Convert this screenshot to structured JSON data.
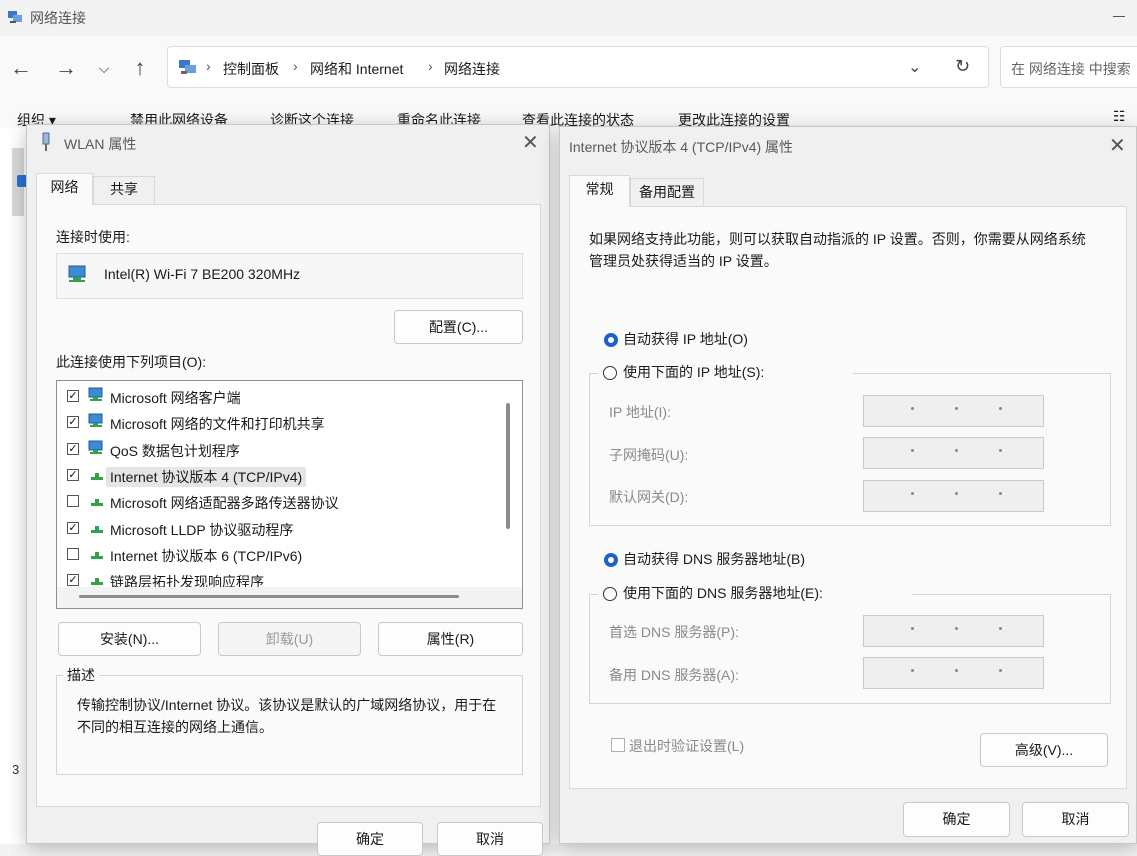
{
  "explorer": {
    "title": "网络连接",
    "breadcrumb": [
      "控制面板",
      "网络和 Internet",
      "网络连接"
    ],
    "search_placeholder": "在 网络连接 中搜索",
    "commands": [
      "组织 ▾",
      "禁用此网络设备",
      "诊断这个连接",
      "重命名此连接",
      "查看此连接的状态",
      "更改此连接的设置"
    ],
    "status_count": "3"
  },
  "wlan": {
    "title": "WLAN 属性",
    "tabs": [
      "网络",
      "共享"
    ],
    "connect_using_label": "连接时使用:",
    "adapter_name": "Intel(R) Wi-Fi 7 BE200 320MHz",
    "configure_button": "配置(C)...",
    "items_label": "此连接使用下列项目(O):",
    "items": [
      {
        "checked": true,
        "text": "Microsoft 网络客户端",
        "icon": "network-client-icon"
      },
      {
        "checked": true,
        "text": "Microsoft 网络的文件和打印机共享",
        "icon": "network-client-icon"
      },
      {
        "checked": true,
        "text": "QoS 数据包计划程序",
        "icon": "network-client-icon"
      },
      {
        "checked": true,
        "text": "Internet 协议版本 4 (TCP/IPv4)",
        "icon": "protocol-icon",
        "selected": true
      },
      {
        "checked": false,
        "text": "Microsoft 网络适配器多路传送器协议",
        "icon": "protocol-icon"
      },
      {
        "checked": true,
        "text": "Microsoft LLDP 协议驱动程序",
        "icon": "protocol-icon"
      },
      {
        "checked": false,
        "text": "Internet 协议版本 6 (TCP/IPv6)",
        "icon": "protocol-icon"
      },
      {
        "checked": true,
        "text": "链路层拓扑发现响应程序",
        "icon": "protocol-icon"
      }
    ],
    "install_button": "安装(N)...",
    "uninstall_button": "卸载(U)",
    "properties_button": "属性(R)",
    "description_title": "描述",
    "description_text": "传输控制协议/Internet 协议。该协议是默认的广域网络协议，用于在不同的相互连接的网络上通信。",
    "ok_button": "确定",
    "cancel_button": "取消"
  },
  "ipv4": {
    "title": "Internet 协议版本 4 (TCP/IPv4) 属性",
    "tabs": [
      "常规",
      "备用配置"
    ],
    "intro": "如果网络支持此功能，则可以获取自动指派的 IP 设置。否则，你需要从网络系统管理员处获得适当的 IP 设置。",
    "auto_ip": "自动获得 IP 地址(O)",
    "manual_ip": "使用下面的 IP 地址(S):",
    "ip_address_label": "IP 地址(I):",
    "subnet_label": "子网掩码(U):",
    "gateway_label": "默认网关(D):",
    "auto_dns": "自动获得 DNS 服务器地址(B)",
    "manual_dns": "使用下面的 DNS 服务器地址(E):",
    "preferred_dns_label": "首选 DNS 服务器(P):",
    "alternate_dns_label": "备用 DNS 服务器(A):",
    "validate_label": "退出时验证设置(L)",
    "advanced_button": "高级(V)...",
    "ok_button": "确定",
    "cancel_button": "取消"
  },
  "colors": {
    "accent": "#1e62c8"
  }
}
